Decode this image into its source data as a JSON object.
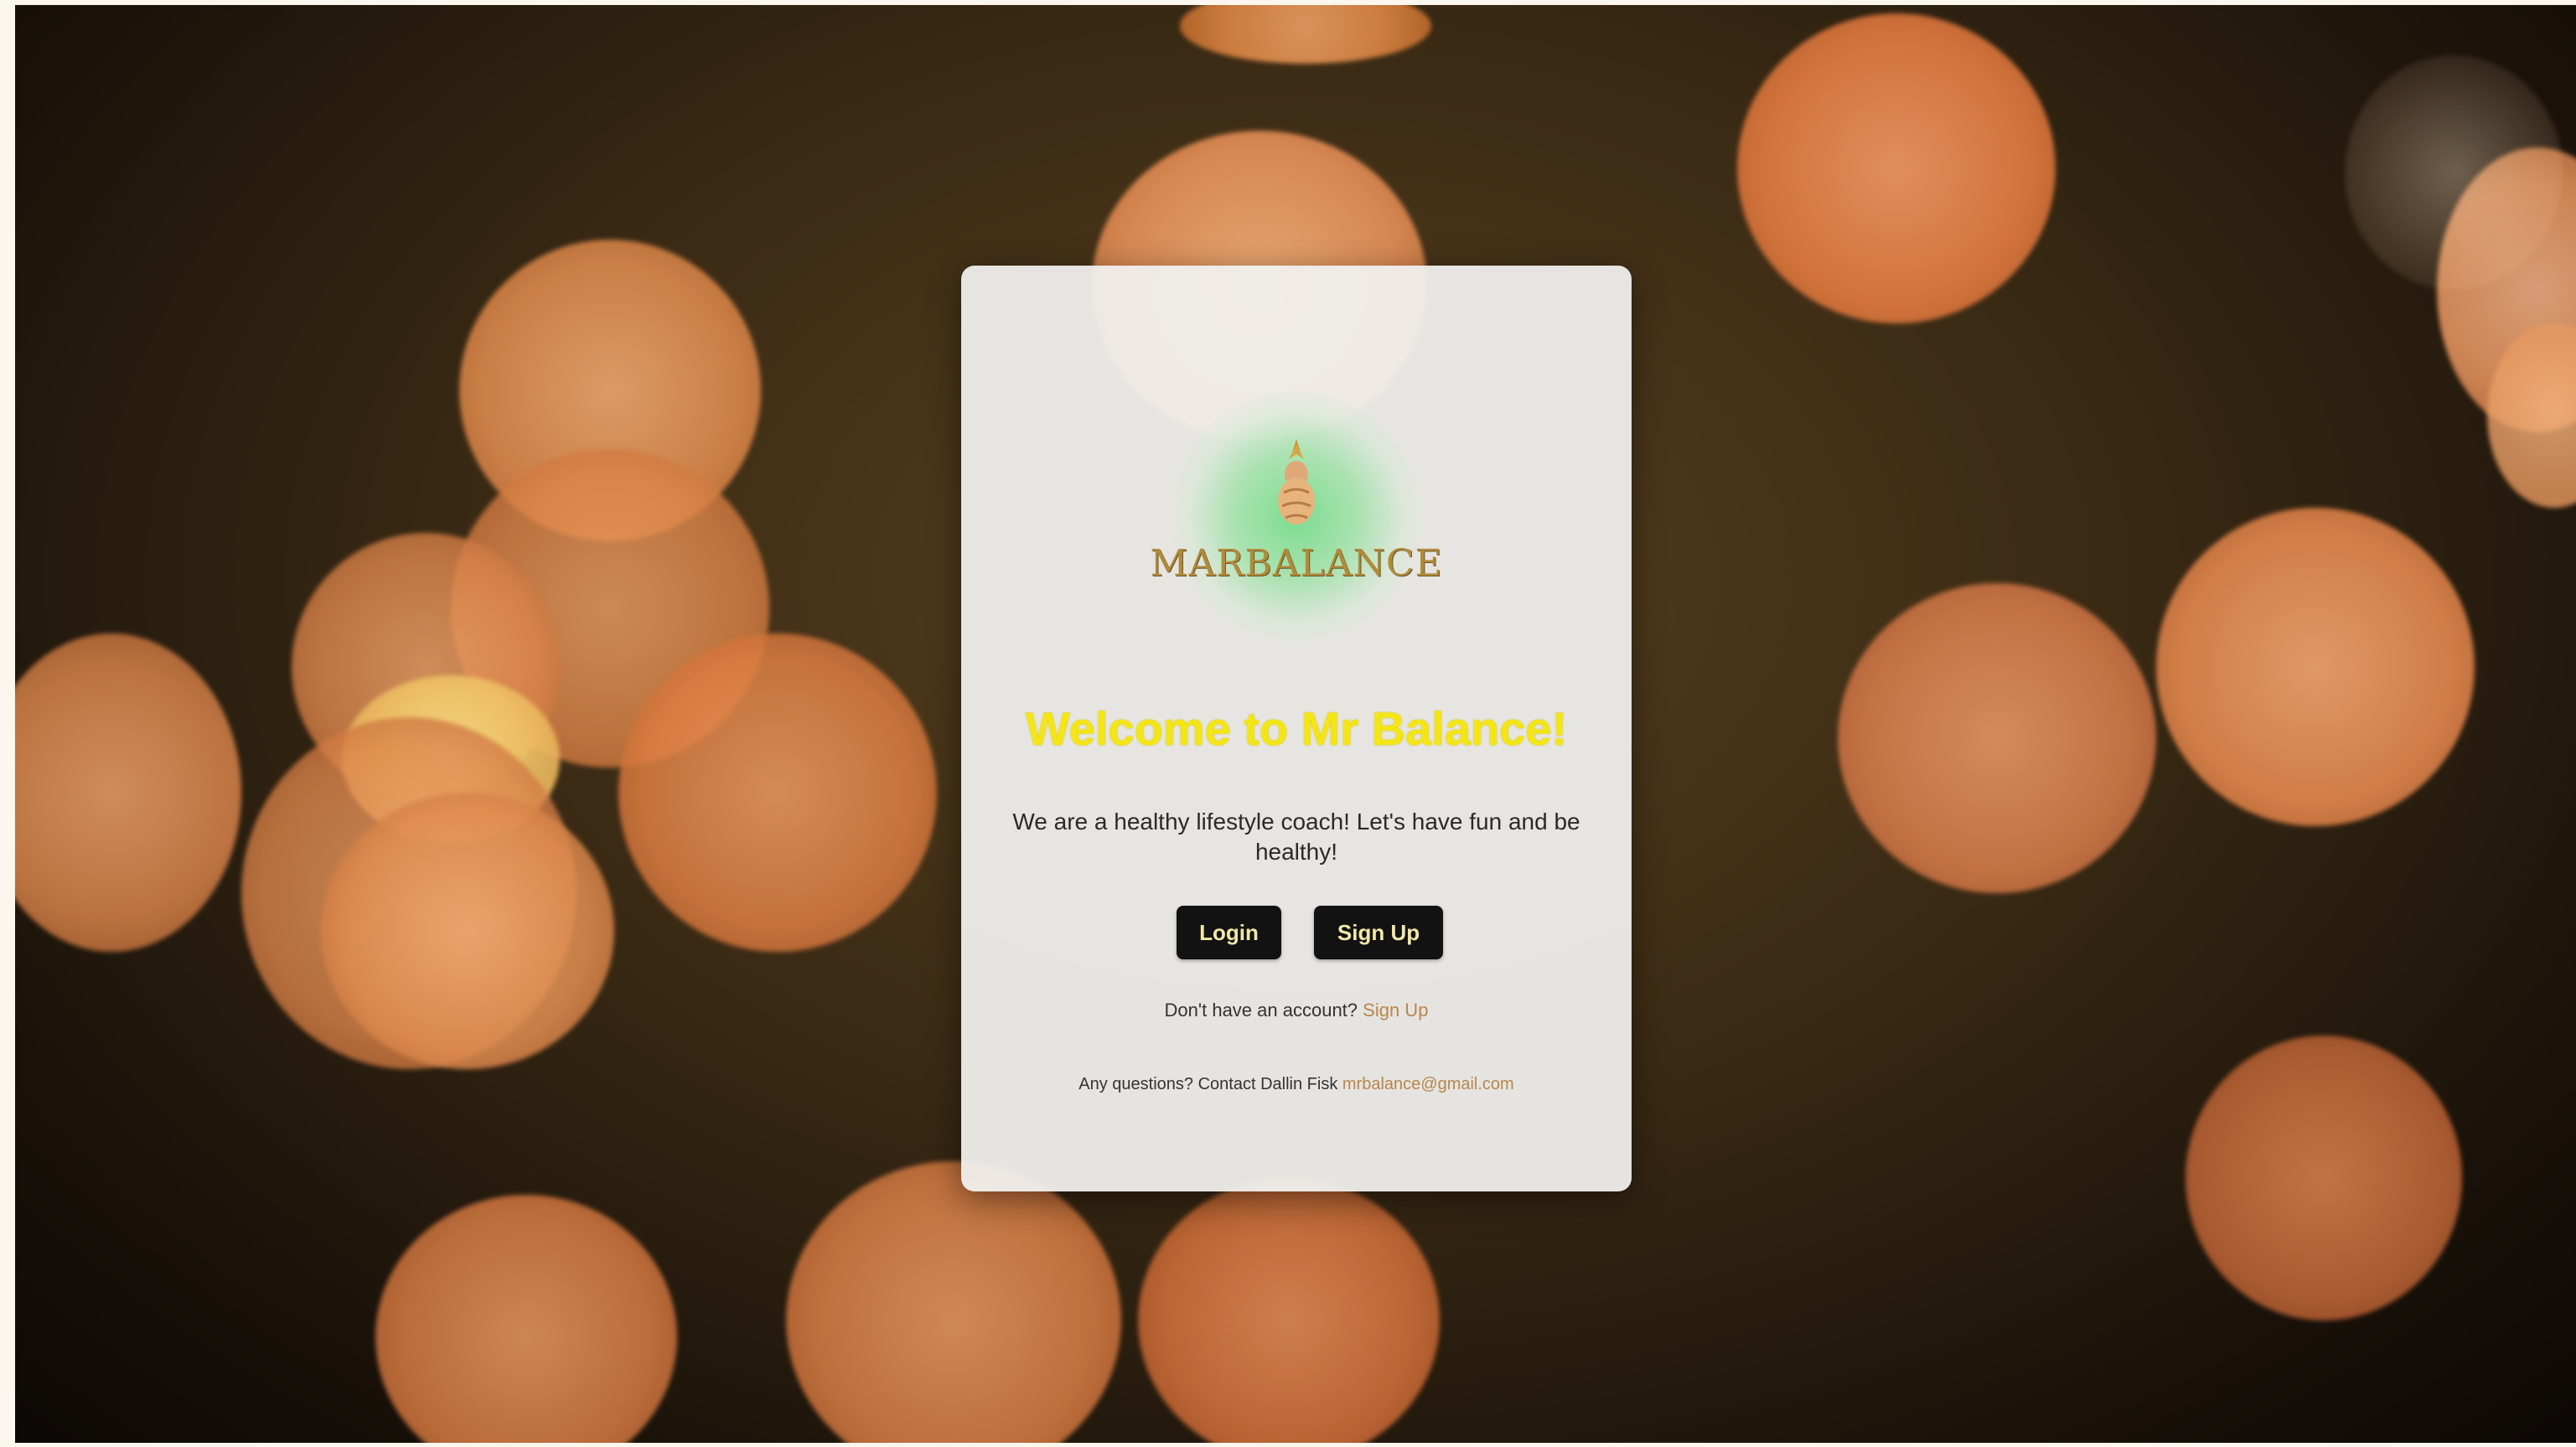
{
  "brand": {
    "logo_text": "MARBALANCE"
  },
  "welcome": {
    "title": "Welcome to Mr Balance!",
    "subtitle": "We are a healthy lifestyle coach! Let's have fun and be healthy!"
  },
  "actions": {
    "login_label": "Login",
    "signup_label": "Sign Up"
  },
  "account": {
    "prompt": "Don't have an account?",
    "link_label": "Sign Up"
  },
  "contact": {
    "prompt": "Any questions? Contact Dallin Fisk",
    "email": "mrbalance@gmail.com"
  },
  "colors": {
    "title": "#f4e514",
    "button_bg": "#121212",
    "button_text": "#f1e7a8",
    "link": "#b8864a",
    "logo_glow": "#76dc8c",
    "logo_gold": "#b08b3c"
  },
  "icons": {
    "logo": "pineapple-logo-icon"
  }
}
